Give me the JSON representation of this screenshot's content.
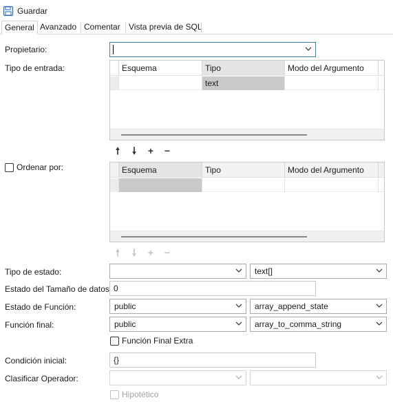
{
  "toolbar": {
    "save_label": "Guardar",
    "save_icon": "floppy-disk-icon"
  },
  "tabs": [
    {
      "label": "General",
      "active": true
    },
    {
      "label": "Avanzado",
      "active": false
    },
    {
      "label": "Comentar",
      "active": false
    },
    {
      "label": "Vista previa de SQL",
      "active": false
    }
  ],
  "form": {
    "owner": {
      "label": "Propietario:",
      "value": ""
    },
    "input_type": {
      "label": "Tipo de entrada:",
      "columns": [
        "Esquema",
        "Tipo",
        "Modo del Argumento"
      ],
      "rows": [
        {
          "schema": "",
          "type": "text",
          "mode": ""
        }
      ]
    },
    "order_by": {
      "label": "Ordenar por:",
      "checked": false,
      "columns": [
        "Esquema",
        "Tipo",
        "Modo del Argumento"
      ],
      "rows": [
        {
          "schema": "",
          "type": "",
          "mode": ""
        }
      ]
    },
    "controls": {
      "up": "🠕",
      "down": "🠗",
      "add": "+",
      "remove": "−"
    },
    "state_type": {
      "label": "Tipo de estado:",
      "schema": "",
      "type": "text[]"
    },
    "state_data_size": {
      "label": "Estado del Tamaño de datos:",
      "value": "0"
    },
    "state_function": {
      "label": "Estado de Función:",
      "schema": "public",
      "function": "array_append_state"
    },
    "final_function": {
      "label": "Función final:",
      "schema": "public",
      "function": "array_to_comma_string"
    },
    "final_function_extra": {
      "label": "Función Final Extra",
      "checked": false
    },
    "initial_condition": {
      "label": "Condición inicial:",
      "value": "{}"
    },
    "sort_operator": {
      "label": "Clasificar Operador:",
      "schema": "",
      "operator": ""
    },
    "hypothetical": {
      "label": "Hipotético",
      "checked": false
    }
  }
}
